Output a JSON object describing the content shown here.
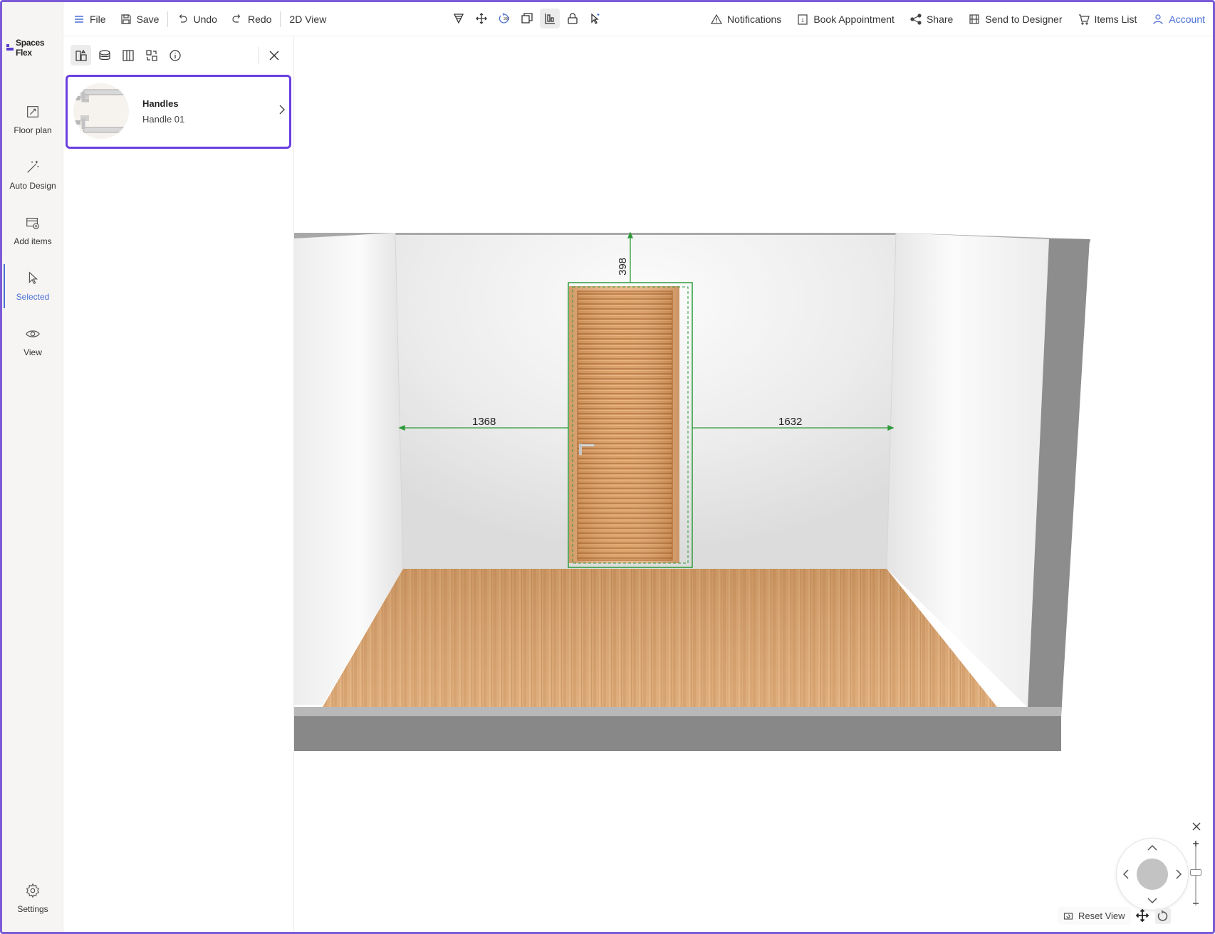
{
  "app": {
    "brand": "Spaces Flex",
    "accent_color": "#4a6fd6",
    "selection_color": "#6a3fe0"
  },
  "sidebar": {
    "items": [
      {
        "label": "Floor plan",
        "icon": "floor-plan-icon"
      },
      {
        "label": "Auto Design",
        "icon": "magic-wand-icon"
      },
      {
        "label": "Add items",
        "icon": "add-items-icon"
      },
      {
        "label": "Selected",
        "icon": "cursor-icon",
        "active": true
      },
      {
        "label": "View",
        "icon": "eye-icon"
      }
    ],
    "settings_label": "Settings"
  },
  "toolbar": {
    "file_label": "File",
    "save_label": "Save",
    "undo_label": "Undo",
    "redo_label": "Redo",
    "view_label": "2D View",
    "tools": [
      "cut-icon",
      "move-icon",
      "rotate-360-icon",
      "duplicate-icon",
      "align-icon",
      "lock-icon",
      "select-icon"
    ],
    "right": {
      "notifications_label": "Notifications",
      "appointment_label": "Book Appointment",
      "share_label": "Share",
      "designer_label": "Send to Designer",
      "items_label": "Items List",
      "account_label": "Account"
    }
  },
  "panel": {
    "tabs": [
      "product-icon",
      "material-icon",
      "panel-layout-icon",
      "replace-icon",
      "info-icon"
    ],
    "selected_item": {
      "category": "Handles",
      "name": "Handle 01"
    }
  },
  "scene": {
    "dimensions": {
      "top": "398",
      "left": "1368",
      "right": "1632"
    },
    "dimension_color": "#2e9a3a"
  },
  "view_controls": {
    "reset_label": "Reset View"
  }
}
